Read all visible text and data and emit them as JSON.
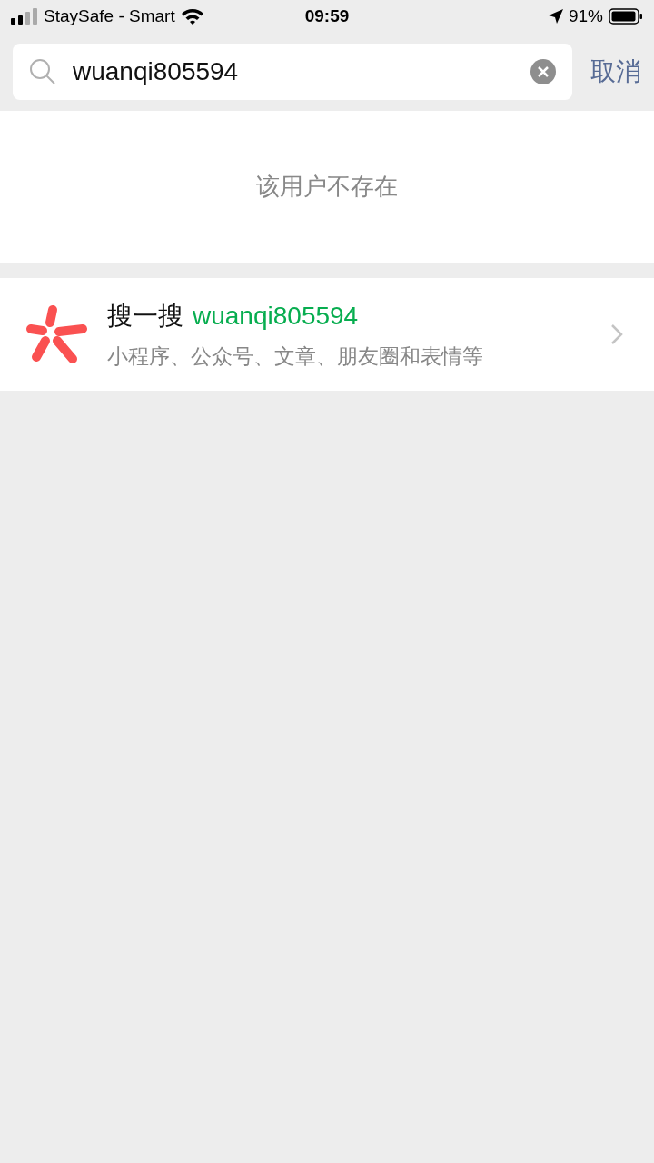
{
  "status_bar": {
    "carrier": "StaySafe - Smart",
    "time": "09:59",
    "battery": "91%"
  },
  "search": {
    "value": "wuanqi805594",
    "cancel": "取消"
  },
  "result": {
    "message": "该用户不存在"
  },
  "search_entry": {
    "label": "搜一搜",
    "query": "wuanqi805594",
    "subtitle": "小程序、公众号、文章、朋友圈和表情等"
  }
}
